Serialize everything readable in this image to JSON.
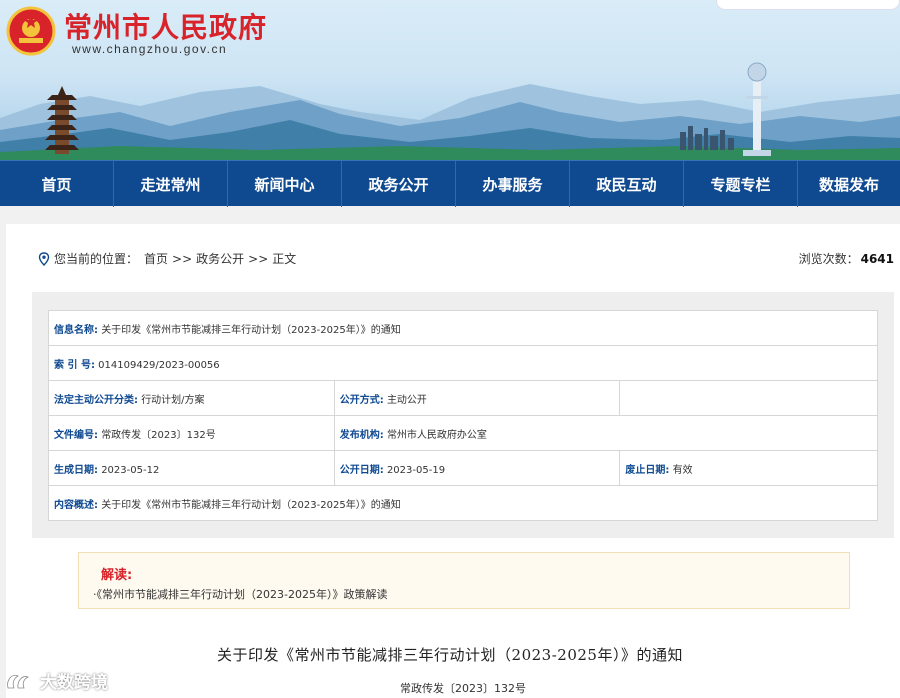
{
  "header": {
    "title": "常州市人民政府",
    "url": "www.changzhou.gov.cn"
  },
  "nav": [
    {
      "label": "首页"
    },
    {
      "label": "走进常州"
    },
    {
      "label": "新闻中心"
    },
    {
      "label": "政务公开"
    },
    {
      "label": "办事服务"
    },
    {
      "label": "政民互动"
    },
    {
      "label": "专题专栏"
    },
    {
      "label": "数据发布"
    }
  ],
  "breadcrumb": {
    "prefix": "您当前的位置：",
    "items": [
      "首页",
      "政务公开",
      "正文"
    ],
    "separator": ">>"
  },
  "views": {
    "label": "浏览次数：",
    "count": "4641"
  },
  "info": {
    "name_label": "信息名称:",
    "name_value": "关于印发《常州市节能减排三年行动计划（2023-2025年）》的通知",
    "index_label": "索 引 号:",
    "index_value": "014109429/2023-00056",
    "category_label": "法定主动公开分类:",
    "category_value": "行动计划/方案",
    "method_label": "公开方式:",
    "method_value": "主动公开",
    "docno_label": "文件编号:",
    "docno_value": "常政传发〔2023〕132号",
    "publisher_label": "发布机构:",
    "publisher_value": "常州市人民政府办公室",
    "created_label": "生成日期:",
    "created_value": "2023-05-12",
    "published_label": "公开日期:",
    "published_value": "2023-05-19",
    "abolished_label": "废止日期:",
    "abolished_value": "有效",
    "summary_label": "内容概述:",
    "summary_value": "关于印发《常州市节能减排三年行动计划（2023-2025年）》的通知"
  },
  "interpretation": {
    "title": "解读:",
    "link": "·《常州市节能减排三年行动计划（2023-2025年）》政策解读"
  },
  "article": {
    "title": "关于印发《常州市节能减排三年行动计划（2023-2025年）》的通知",
    "doc_number": "常政传发〔2023〕132号"
  },
  "watermark": "大数跨境",
  "colors": {
    "brand_red": "#d8232a",
    "nav_blue": "#0f4a91",
    "label_blue": "#0f4a91"
  }
}
